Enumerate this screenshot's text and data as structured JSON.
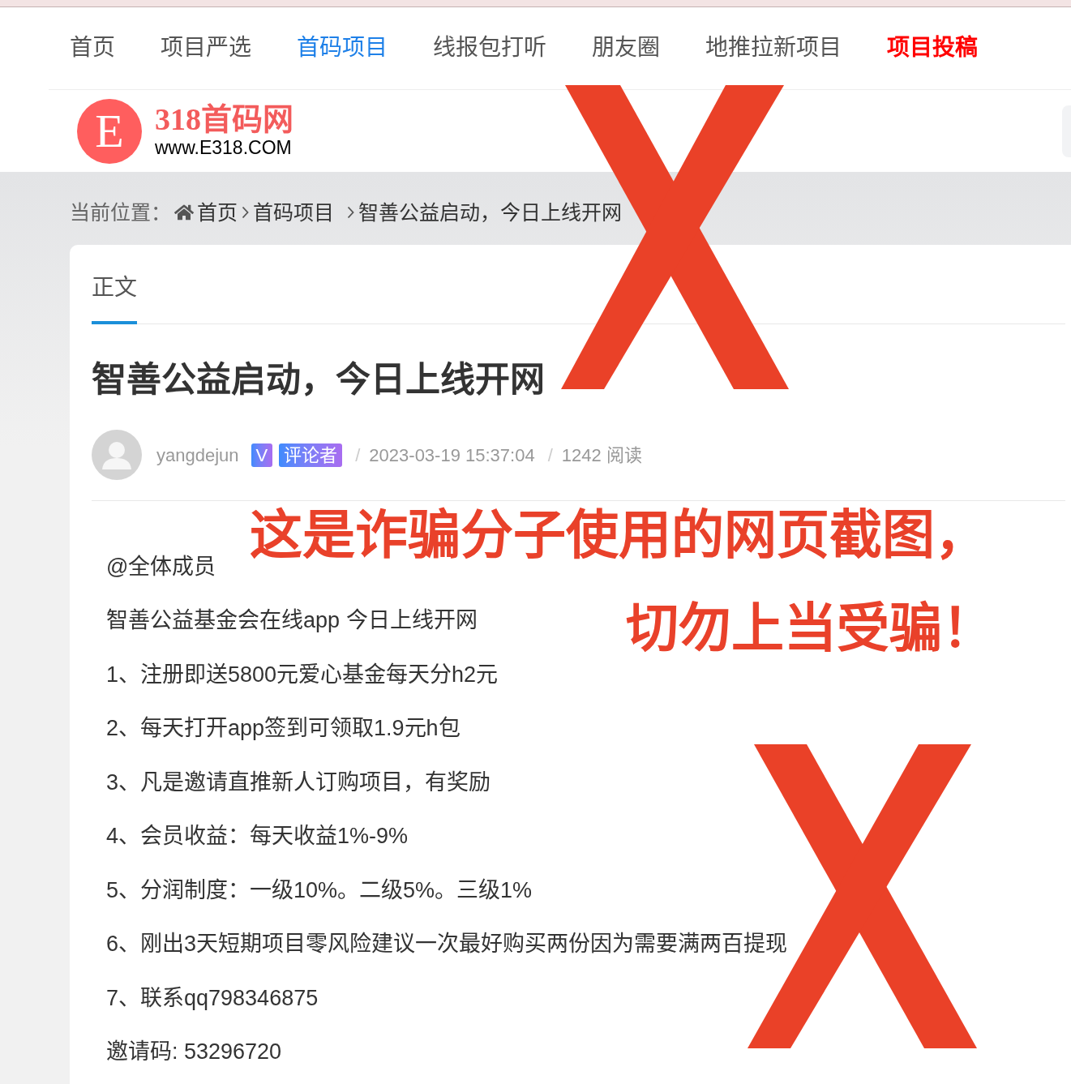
{
  "nav": {
    "items": [
      {
        "label": "首页",
        "selected": false,
        "highlighted": false
      },
      {
        "label": "项目严选",
        "selected": false,
        "highlighted": false
      },
      {
        "label": "首码项目",
        "selected": true,
        "highlighted": false
      },
      {
        "label": "线报包打听",
        "selected": false,
        "highlighted": false
      },
      {
        "label": "朋友圈",
        "selected": false,
        "highlighted": false
      },
      {
        "label": "地推拉新项目",
        "selected": false,
        "highlighted": false
      },
      {
        "label": "项目投稿",
        "selected": false,
        "highlighted": true
      }
    ]
  },
  "logo": {
    "letter": "E",
    "name": "318首码网",
    "url": "www.E318.COM"
  },
  "breadcrumb": {
    "prefix": "当前位置：",
    "items": [
      "首页",
      "首码项目",
      "智善公益启动，今日上线开网"
    ]
  },
  "article": {
    "tabs": [
      {
        "label": "正文",
        "selected": true
      }
    ],
    "title": "智善公益启动，今日上线开网",
    "author": "yangdejun",
    "badges": [
      "V",
      "评论者"
    ],
    "meta": [
      {
        "separator": "/",
        "text": "2023-03-19 15:37:04"
      },
      {
        "separator": "/",
        "text": "1242 阅读"
      }
    ],
    "paragraphs": [
      "@全体成员",
      "智善公益基金会在线app 今日上线开网",
      "1、注册即送5800元爱心基金每天分h2元",
      "2、每天打开app签到可领取1.9元h包",
      "3、凡是邀请直推新人订购项目，有奖励",
      "4、会员收益：每天收益1%-9%",
      "5、分润制度：一级10%。二级5%。三级1%",
      "6、刚出3天短期项目零风险建议一次最好购买两份因为需要满两百提现",
      "7、联系qq798346875",
      "邀请码: 53296720"
    ]
  },
  "overlay": {
    "warning_lines": [
      "这是诈骗分子使用的网页截图，",
      "切勿上当受骗！"
    ]
  }
}
